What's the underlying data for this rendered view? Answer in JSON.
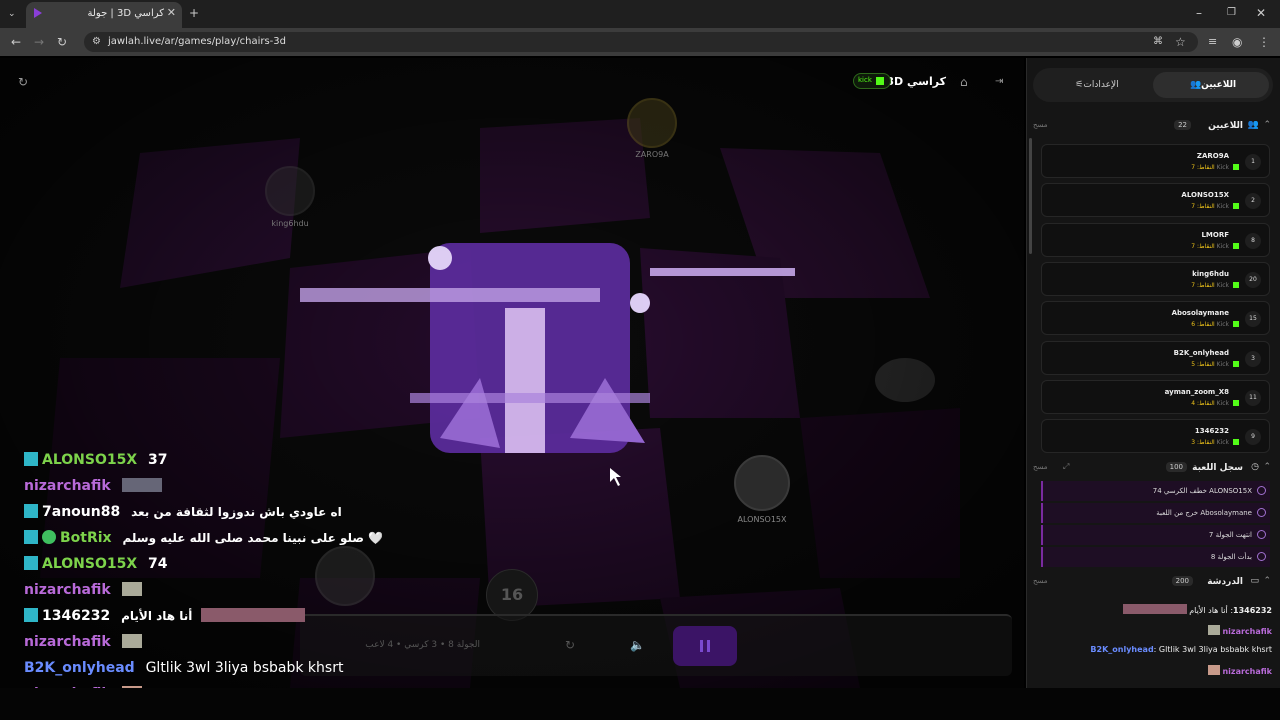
{
  "browser": {
    "tab_title": "كراسي 3D | جولة",
    "url": "jawlah.live/ar/games/play/chairs-3d",
    "close_glyph": "✕",
    "new_tab_glyph": "+"
  },
  "game_header": {
    "title": "كراسي 3D",
    "kick_label": "kick",
    "refresh_icon": "refresh-icon",
    "home_icon": "home-icon",
    "exit_icon": "exit-icon"
  },
  "game": {
    "countdown": "16",
    "round_info": "الجولة 8 • 3 كرسي • 4 لاعب",
    "avatars": [
      {
        "label": "ZARO9A"
      },
      {
        "label": "king6hdu"
      },
      {
        "label": "ALONSO15X"
      }
    ]
  },
  "overlay_chat": [
    {
      "user": "ALONSO15X",
      "text": "37",
      "user_color": "#7dd34b"
    },
    {
      "user": "nizarchafik",
      "text": "",
      "user_color": "#b86ad8"
    },
    {
      "user": "7anoun88",
      "text": "اه عاودي باش ندوزوا لثقافة من بعد",
      "user_color": "#ffffff"
    },
    {
      "user": "BotRix",
      "text": "صلو على نبينا محمد صلى الله عليه وسلم 🤍",
      "user_color": "#7dd34b"
    },
    {
      "user": "ALONSO15X",
      "text": "74",
      "user_color": "#7dd34b"
    },
    {
      "user": "nizarchafik",
      "text": "",
      "user_color": "#b86ad8"
    },
    {
      "user": "1346232",
      "text": "أنا هاد الأيام",
      "user_color": "#ffffff"
    },
    {
      "user": "nizarchafik",
      "text": "",
      "user_color": "#b86ad8"
    },
    {
      "user": "B2K_onlyhead",
      "text": "Gltlik 3wl 3liya bsbabk khsrt",
      "user_color": "#6a8cff"
    },
    {
      "user": "nizarchafik",
      "text": "",
      "user_color": "#b86ad8"
    }
  ],
  "sidebar": {
    "tab_players": "اللاعبين",
    "tab_settings": "الإعدادات",
    "players_section": {
      "title": "اللاعبين",
      "count": "22",
      "clear": "مسح"
    },
    "players": [
      {
        "name": "ZARO9A",
        "points": "النقاط: 7",
        "rank": "1"
      },
      {
        "name": "ALONSO15X",
        "points": "النقاط: 7",
        "rank": "2"
      },
      {
        "name": "LMORF",
        "points": "النقاط: 7",
        "rank": "8"
      },
      {
        "name": "king6hdu",
        "points": "النقاط: 7",
        "rank": "20"
      },
      {
        "name": "Abosolaymane",
        "points": "النقاط: 6",
        "rank": "15"
      },
      {
        "name": "B2K_onlyhead",
        "points": "النقاط: 5",
        "rank": "3"
      },
      {
        "name": "ayman_zoom_X8",
        "points": "النقاط: 4",
        "rank": "11"
      },
      {
        "name": "1346232",
        "points": "النقاط: 3",
        "rank": "9"
      }
    ],
    "kick_word": "Kick",
    "log_section": {
      "title": "سجل اللعبة",
      "count": "100",
      "clear": "مسح"
    },
    "log": [
      "ALONSO15X خطف الكرسي 74",
      "Abosolaymane خرج من اللعبة",
      "انتهت الجولة 7",
      "بدأت الجولة 8"
    ],
    "chat_section": {
      "title": "الدردشة",
      "count": "200",
      "clear": "مسح"
    },
    "chat": [
      {
        "user": "1346232",
        "text": "أنا هاد الأيام"
      },
      {
        "user": "nizarchafik",
        "text": ""
      },
      {
        "user": "B2K_onlyhead",
        "text": "Gltlik 3wl 3liya bsbabk khsrt"
      },
      {
        "user": "nizarchafik",
        "text": ""
      }
    ]
  },
  "colors": {
    "accent": "#7a2aa0",
    "kick": "#53fc18",
    "gold": "#f0c419"
  }
}
